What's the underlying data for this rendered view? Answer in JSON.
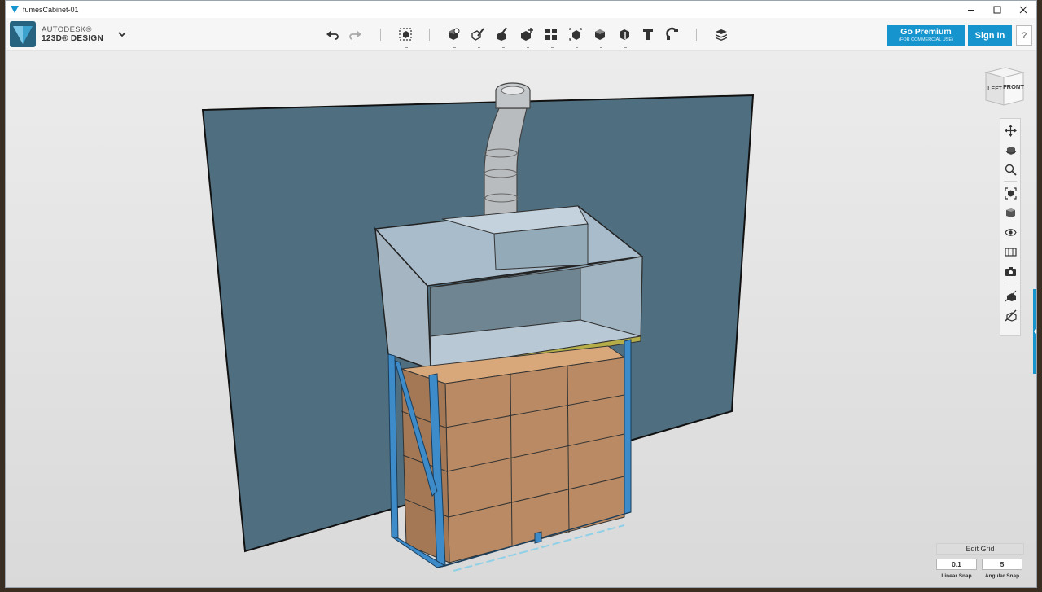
{
  "window": {
    "title": "fumesCabinet-01"
  },
  "app": {
    "brand_line1": "AUTODESK®",
    "brand_line2": "123D® DESIGN"
  },
  "toolbar": {
    "tools": [
      {
        "name": "undo-icon"
      },
      {
        "name": "redo-icon"
      },
      {
        "name": "transform-icon"
      },
      {
        "name": "primitives-icon"
      },
      {
        "name": "sketch-icon"
      },
      {
        "name": "construct-icon"
      },
      {
        "name": "modify-icon"
      },
      {
        "name": "pattern-icon"
      },
      {
        "name": "group-icon"
      },
      {
        "name": "combine-icon"
      },
      {
        "name": "measure-icon"
      },
      {
        "name": "text-icon"
      },
      {
        "name": "snap-icon"
      },
      {
        "name": "material-icon"
      }
    ]
  },
  "account": {
    "premium_label": "Go Premium",
    "premium_sub": "(FOR COMMERCIAL USE)",
    "signin_label": "Sign In",
    "help_label": "?"
  },
  "viewcube": {
    "left_label": "LEFT",
    "front_label": "FRONT"
  },
  "navbar": {
    "tools": [
      "pan-icon",
      "orbit-icon",
      "zoom-icon",
      "fit-icon",
      "views-icon",
      "visibility-icon",
      "materials-icon",
      "screenshot-icon",
      "grid-icon",
      "grid-hide-icon"
    ]
  },
  "grid": {
    "edit_label": "Edit Grid",
    "linear_snap_value": "0.1",
    "angular_snap_value": "5",
    "linear_snap_label": "Linear Snap",
    "angular_snap_label": "Angular Snap"
  },
  "colors": {
    "accent": "#1594ce",
    "wall": "#4f6f80",
    "frame": "#3d8bc9",
    "box": "#b98a63",
    "hood": "#a9b9c5"
  }
}
